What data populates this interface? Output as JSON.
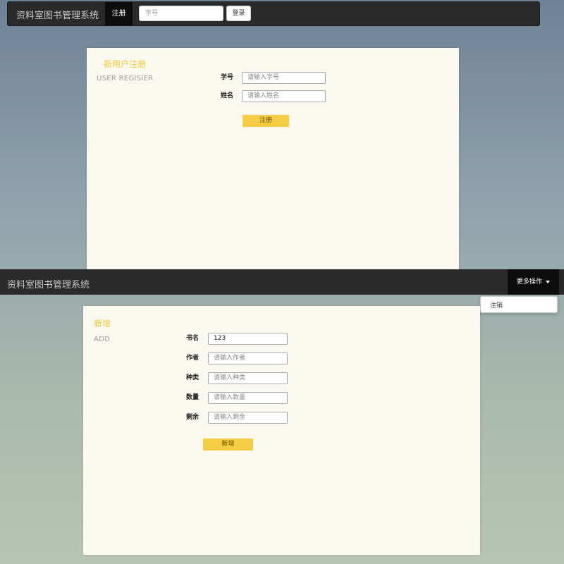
{
  "app_title": "资料室图书管理系统",
  "register_screen": {
    "navbar": {
      "active_tab": "注册",
      "id_placeholder": "学号",
      "login_label": "登录"
    },
    "panel": {
      "title": "新用户注册",
      "subtitle": "USER REGISIER",
      "fields": [
        {
          "label": "学号",
          "placeholder": "请输入学号"
        },
        {
          "label": "姓名",
          "placeholder": "请输入姓名"
        }
      ],
      "submit_label": "注册"
    }
  },
  "add_screen": {
    "navbar": {
      "dropdown_label": "更多操作",
      "dropdown_items": [
        "注销"
      ]
    },
    "panel": {
      "title": "新增",
      "subtitle": "ADD",
      "fields": [
        {
          "label": "书名",
          "value": "123"
        },
        {
          "label": "作者",
          "placeholder": "请输入作者"
        },
        {
          "label": "种类",
          "placeholder": "请输入种类"
        },
        {
          "label": "数量",
          "placeholder": "请输入数量"
        },
        {
          "label": "剩余",
          "placeholder": "请输入剩余"
        }
      ],
      "submit_label": "新增"
    }
  },
  "colors": {
    "navbar": "#2a2a2a",
    "accent_yellow": "#f5cd45",
    "panel_bg": "#fbf9ef"
  }
}
